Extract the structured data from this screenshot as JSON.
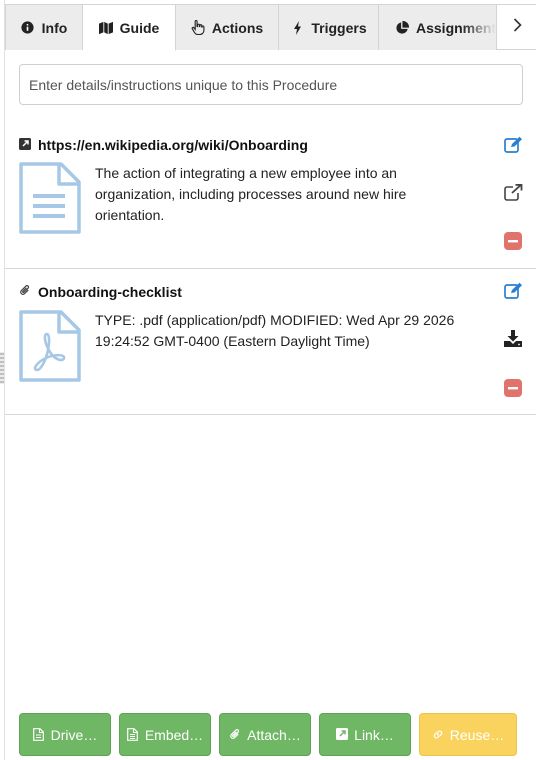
{
  "tabs": [
    {
      "label": "Info",
      "icon": "info-circle-icon",
      "active": false
    },
    {
      "label": "Guide",
      "icon": "map-icon",
      "active": true
    },
    {
      "label": "Actions",
      "icon": "pointer-hand-icon",
      "active": false
    },
    {
      "label": "Triggers",
      "icon": "bolt-icon",
      "active": false
    },
    {
      "label": "Assignment",
      "icon": "pie-chart-icon",
      "active": false
    }
  ],
  "tab_next_icon": "chevron-right-icon",
  "instructions": {
    "placeholder": "Enter details/instructions unique to this Procedure",
    "value": ""
  },
  "items": [
    {
      "title": "https://en.wikipedia.org/wiki/Onboarding",
      "type_icon": "external-link-square-icon",
      "thumb_icon": "document-icon",
      "description": "The action of integrating a new employee into an organization, including processes around new hire orientation.",
      "actions": [
        "edit-icon",
        "open-external-icon",
        "remove-icon"
      ]
    },
    {
      "title": "Onboarding-checklist",
      "type_icon": "paperclip-icon",
      "thumb_icon": "pdf-document-icon",
      "description": "TYPE: .pdf (application/pdf) MODIFIED: Wed Apr 29 2026 19:24:52 GMT-0400 (Eastern Daylight Time)",
      "actions": [
        "edit-icon",
        "download-icon",
        "remove-icon"
      ]
    }
  ],
  "buttons": [
    {
      "label": "Drive…",
      "icon": "file-icon"
    },
    {
      "label": "Embed…",
      "icon": "file-text-icon"
    },
    {
      "label": "Attach…",
      "icon": "paperclip-icon"
    },
    {
      "label": "Link…",
      "icon": "external-link-square-icon"
    },
    {
      "label": "Reuse…",
      "icon": "link-icon"
    }
  ],
  "colors": {
    "accent_blue": "#2a7fd0",
    "thumb_blue": "#a6c8e6",
    "danger": "#e0736b",
    "button_green": "#6fb765",
    "button_yellow": "#f9d35e"
  }
}
